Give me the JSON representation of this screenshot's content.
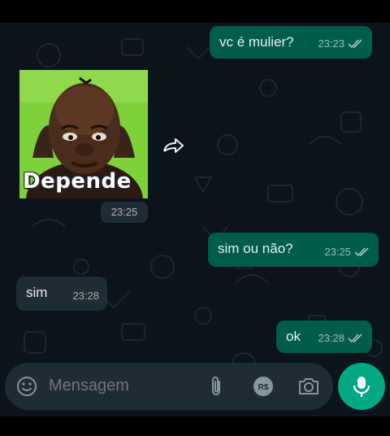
{
  "messages": [
    {
      "direction": "out",
      "text": "vc é mulier?",
      "time": "23:23",
      "status": "read"
    },
    {
      "direction": "in",
      "type": "sticker",
      "sticker_caption": "Depende",
      "time": "23:25"
    },
    {
      "direction": "out",
      "text": "sim ou não?",
      "time": "23:25",
      "status": "read"
    },
    {
      "direction": "in",
      "text": "sim",
      "time": "23:28"
    },
    {
      "direction": "out",
      "text": "ok",
      "time": "23:28",
      "status": "read"
    }
  ],
  "composer": {
    "placeholder": "Mensagem",
    "payment_symbol": "R$"
  },
  "colors": {
    "chat_background": "#0b141a",
    "outgoing_bubble": "#005c4b",
    "incoming_bubble": "#202c33",
    "composer_background": "#1f2c34",
    "accent": "#00a884"
  },
  "icons": [
    "emoji-icon",
    "paperclip-icon",
    "payment-icon",
    "camera-icon",
    "microphone-icon",
    "forward-icon",
    "double-check-icon"
  ]
}
